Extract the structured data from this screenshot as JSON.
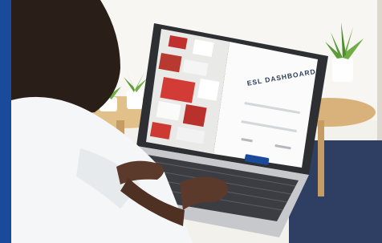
{
  "screen": {
    "title": "ESL DASHBOARD"
  },
  "colors": {
    "accent": "#1a4b9a",
    "wall": "#f3f1ec",
    "shirt": "#f4f6f7",
    "laptop": "#2d2f33",
    "table": "#d8b27a",
    "plant": "#5b9b3a"
  },
  "icons": [
    "plant-icon"
  ]
}
